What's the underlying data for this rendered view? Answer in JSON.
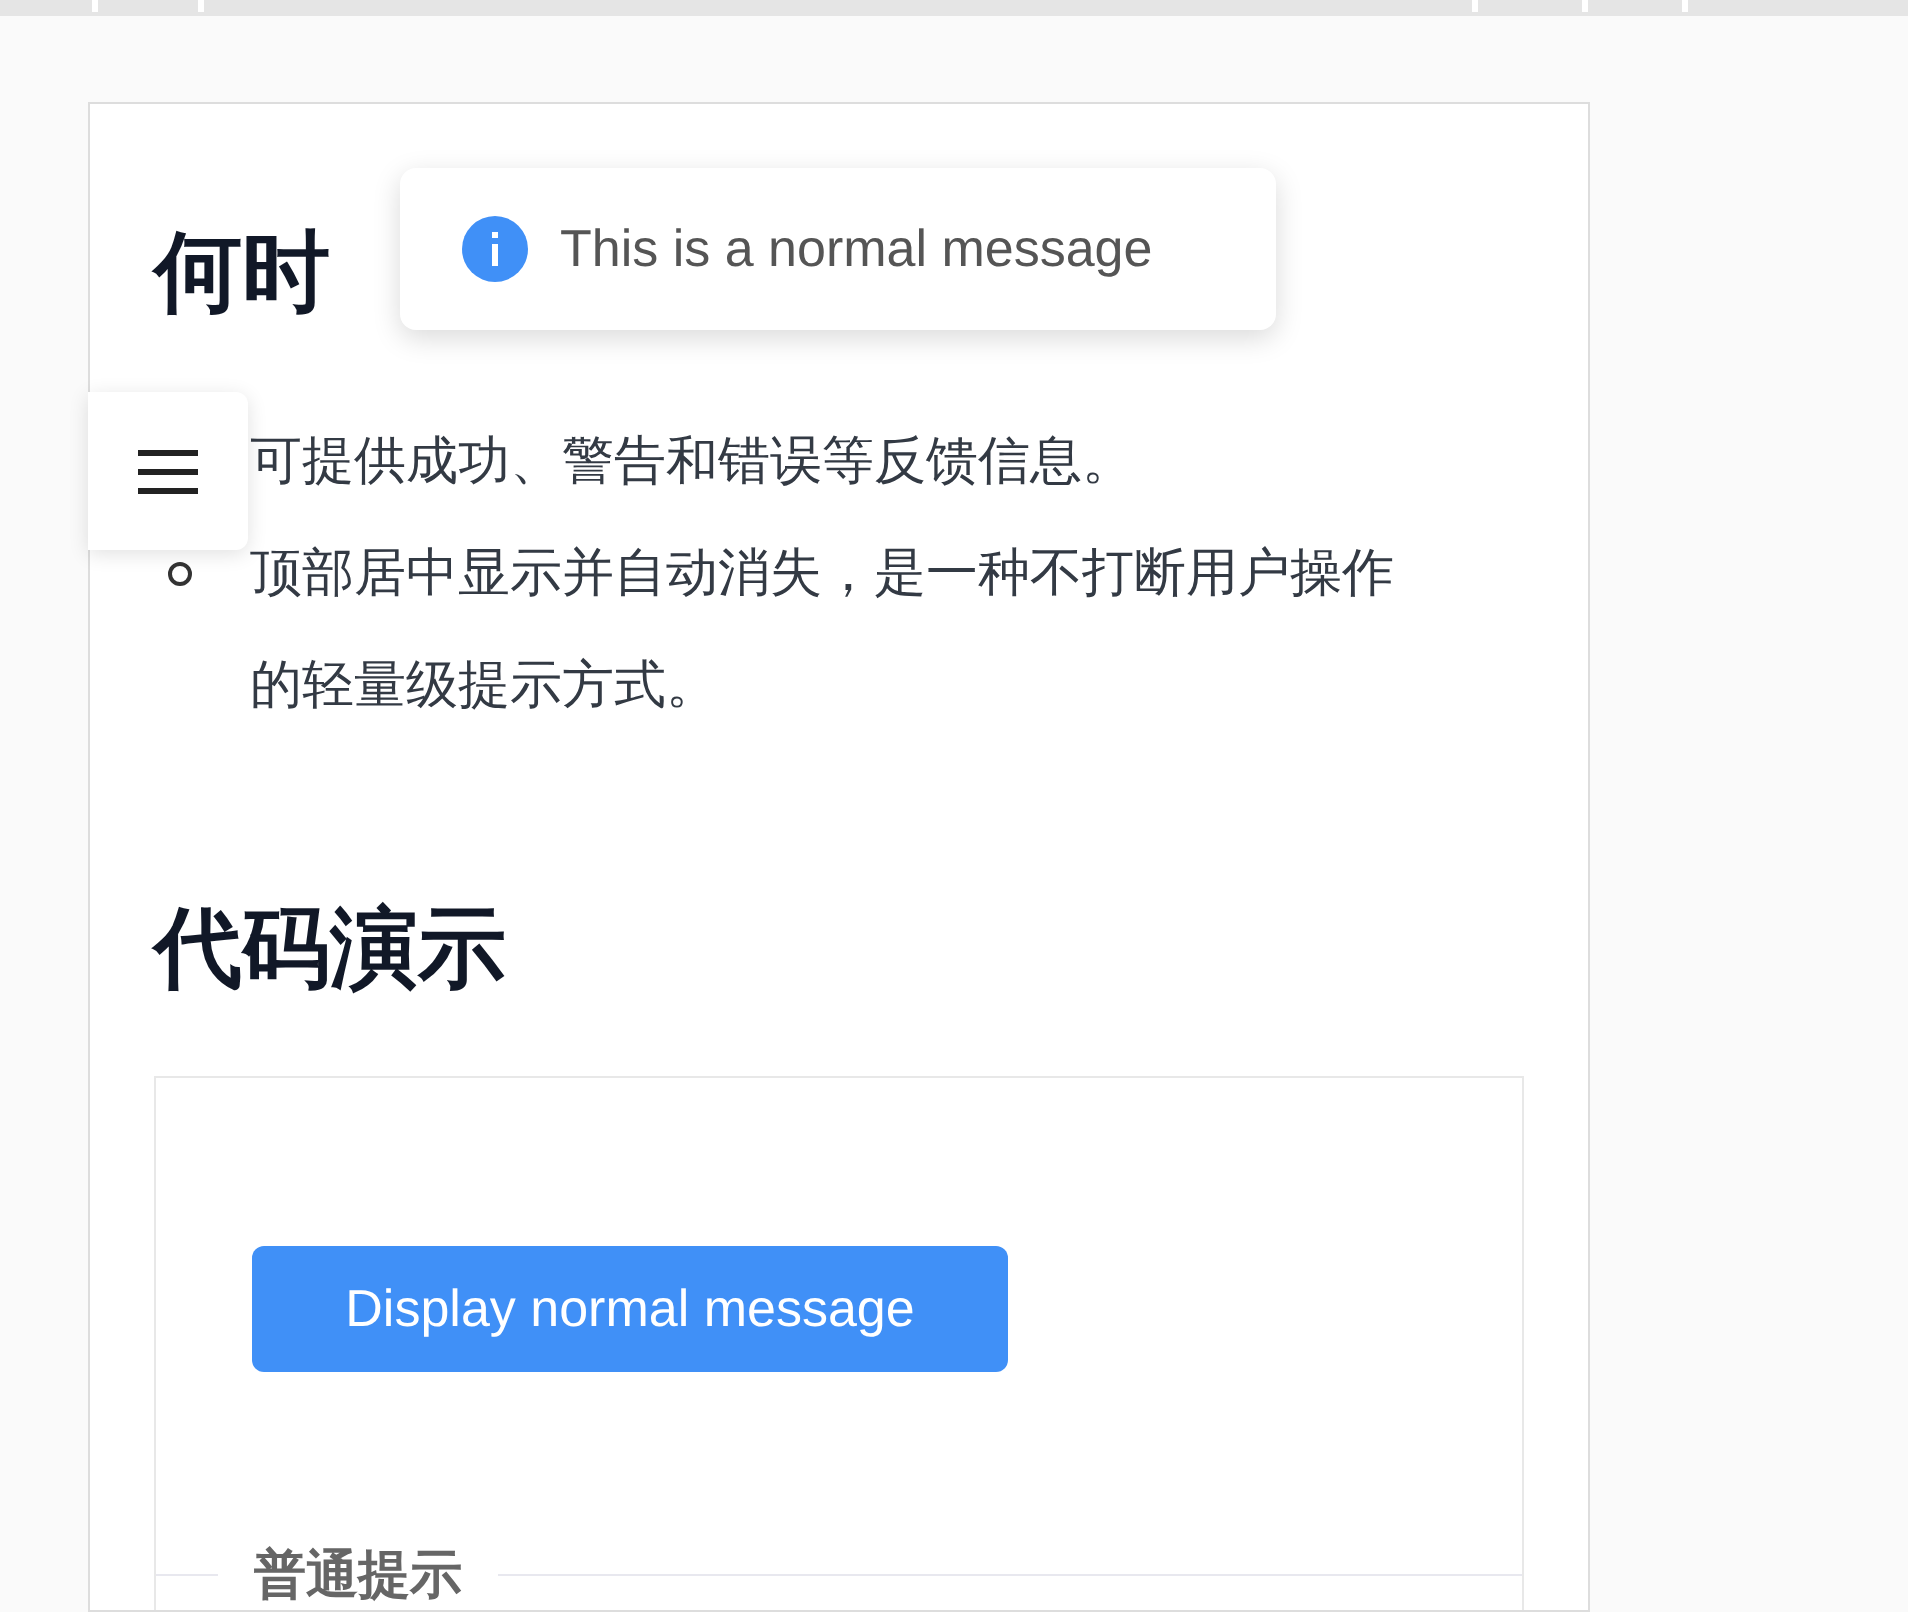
{
  "toast": {
    "kind": "info",
    "text": "This is a normal message"
  },
  "section_heading": "何时",
  "list": [
    "可提供成功、警告和错误等反馈信息。",
    "顶部居中显示并自动消失，是一种不打断用户操作的轻量级提示方式。"
  ],
  "demo_heading": "代码演示",
  "demo": {
    "button": "Display normal message",
    "divider_label": "普通提示"
  }
}
